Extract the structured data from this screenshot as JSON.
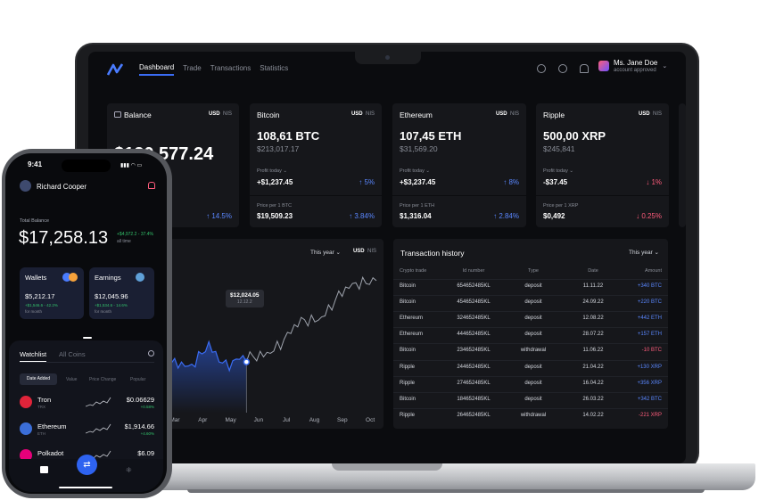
{
  "nav": {
    "links": [
      "Dashboard",
      "Trade",
      "Transactions",
      "Statistics"
    ],
    "user_name": "Ms. Jane Doe",
    "user_status": "account approved"
  },
  "balance_card": {
    "title": "Balance",
    "cur_usd": "USD",
    "cur_nis": "NIS",
    "amount": "$120,577.24",
    "change": "14.5%"
  },
  "coins": [
    {
      "title": "Bitcoin",
      "cur_usd": "USD",
      "cur_nis": "NIS",
      "amount": "108,61 BTC",
      "usd": "$213,017.17",
      "profit_label": "Profit today",
      "profit": "+$1,237.45",
      "profit_change": "5%",
      "price_label": "Price per 1 BTC",
      "price": "$19,509.23",
      "price_change": "3.84%"
    },
    {
      "title": "Ethereum",
      "cur_usd": "USD",
      "cur_nis": "NIS",
      "amount": "107,45 ETH",
      "usd": "$31,569.20",
      "profit_label": "Profit today",
      "profit": "+$3,237.45",
      "profit_change": "8%",
      "price_label": "Price per 1 ETH",
      "price": "$1,316.04",
      "price_change": "2.84%"
    },
    {
      "title": "Ripple",
      "cur_usd": "USD",
      "cur_nis": "NIS",
      "amount": "500,00 XRP",
      "usd": "$245,841",
      "profit_label": "Profit today",
      "profit": "-$37.45",
      "profit_change": "1%",
      "price_label": "Price per 1 XRP",
      "price": "$0,492",
      "price_change": "0.25%"
    }
  ],
  "chart": {
    "period": "This year",
    "cur_usd": "USD",
    "cur_nis": "NIS",
    "tooltip_value": "$12,024.05",
    "tooltip_date": "12.12.2"
  },
  "chart_data": {
    "type": "line",
    "x": [
      "Mar",
      "Apr",
      "May",
      "Jun",
      "Jul",
      "Aug",
      "Sep",
      "Oct"
    ],
    "title": "",
    "xlabel": "",
    "ylabel": "",
    "grid": false,
    "series": [
      {
        "values": [
          5.2,
          4.6,
          6.8,
          4.9,
          5.4,
          6.1,
          6.6,
          8.0,
          8.6,
          9.8,
          10.6,
          11.4
        ]
      }
    ]
  },
  "transactions": {
    "title": "Transaction history",
    "period": "This year",
    "headers": [
      "Crypto trade",
      "Id number",
      "Type",
      "Date",
      "Amount"
    ],
    "rows": [
      [
        "Bitcoin",
        "654652485KL",
        "deposit",
        "11.11.22",
        "+340 BTC"
      ],
      [
        "Bitcoin",
        "454652485KL",
        "deposit",
        "24.09.22",
        "+220 BTC"
      ],
      [
        "Ethereum",
        "324652485KL",
        "deposit",
        "12.08.22",
        "+442 ETH"
      ],
      [
        "Ethereum",
        "444652485KL",
        "deposit",
        "28.07.22",
        "+157 ETH"
      ],
      [
        "Bitcoin",
        "234652485KL",
        "withdrawal",
        "11.06.22",
        "-10 BTC"
      ],
      [
        "Ripple",
        "244652485KL",
        "deposit",
        "21.04.22",
        "+130 XRP"
      ],
      [
        "Ripple",
        "274652485KL",
        "deposit",
        "16.04.22",
        "+356 XRP"
      ],
      [
        "Bitcoin",
        "184652485KL",
        "deposit",
        "26.03.22",
        "+342 BTC"
      ],
      [
        "Ripple",
        "264652485KL",
        "withdrawal",
        "14.02.22",
        "-221 XRP"
      ]
    ]
  },
  "phone": {
    "time": "9:41",
    "user": "Richard Cooper",
    "total_label": "Total Balance",
    "total": "$17,258.13",
    "total_change": "+$4,972.2 - 37.4%",
    "total_period": "all time",
    "wallets": {
      "title": "Wallets",
      "amount": "$5,212.17",
      "change": "+$1,546.6 - 42.2%",
      "period": "for month"
    },
    "earnings": {
      "title": "Earnings",
      "amount": "$12,045.96",
      "change": "+$1,534.6 - 14.6%",
      "period": "for month"
    },
    "tabs": [
      "Watchlist",
      "All Coins"
    ],
    "filters": [
      "Date Added",
      "Value",
      "Price Change",
      "Popular"
    ],
    "coins": [
      {
        "name": "Tron",
        "sym": "TRX",
        "price": "$0.06629",
        "change": "+0.58%"
      },
      {
        "name": "Ethereum",
        "sym": "ETH",
        "price": "$1,914.66",
        "change": "+4.60%"
      },
      {
        "name": "Polkadot",
        "sym": "DOT",
        "price": "$6.09",
        "change": "+"
      }
    ]
  }
}
